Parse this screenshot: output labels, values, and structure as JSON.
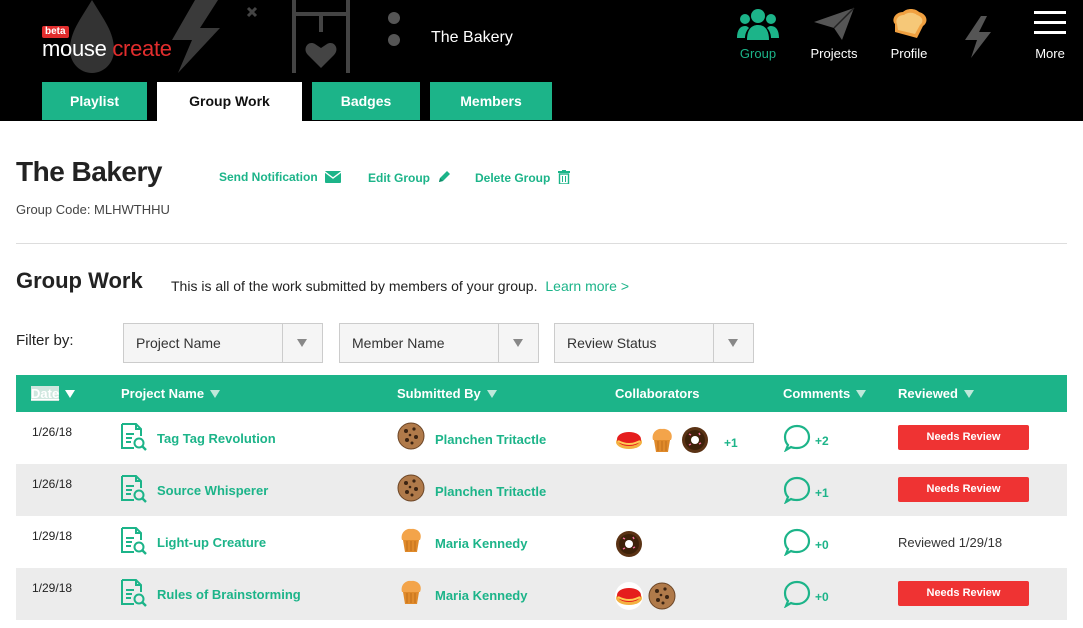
{
  "header": {
    "logo_beta": "beta",
    "logo_word1": "mouse",
    "logo_word2": "create",
    "site_title": "The Bakery",
    "nav": [
      {
        "label": "Group",
        "icon": "group-icon",
        "active": true
      },
      {
        "label": "Projects",
        "icon": "paper-plane-icon"
      },
      {
        "label": "Profile",
        "icon": "toast-icon"
      },
      {
        "label": "",
        "icon": "lightning-icon"
      },
      {
        "label": "More",
        "icon": "hamburger-menu-icon"
      }
    ],
    "tabs": [
      "Playlist",
      "Group Work",
      "Badges",
      "Members"
    ],
    "active_tab": "Group Work"
  },
  "group": {
    "title": "The Bakery",
    "actions": {
      "send_notification": "Send Notification",
      "edit_group": "Edit Group",
      "delete_group": "Delete Group"
    },
    "code": "Group Code: MLHWTHHU"
  },
  "group_work": {
    "title": "Group Work",
    "description": "This is all of the work submitted by members of your group.",
    "learn_more": "Learn more >"
  },
  "filters": {
    "label": "Filter by:",
    "project": "Project Name",
    "member": "Member Name",
    "status": "Review Status"
  },
  "table": {
    "columns": [
      "Date",
      "Project Name",
      "Submitted By",
      "Collaborators",
      "Comments",
      "Reviewed"
    ],
    "rows": [
      {
        "date": "1/26/18",
        "project": "Tag Tag Revolution",
        "submitter": "Planchen Tritactle",
        "submitter_avatar": "cookie",
        "collaborators": [
          "pie",
          "muffin",
          "donut"
        ],
        "collab_more": "+1",
        "comments": "+2",
        "review_label": "Needs Review",
        "reviewed": false
      },
      {
        "date": "1/26/18",
        "project": "Source Whisperer",
        "submitter": "Planchen Tritactle",
        "submitter_avatar": "cookie",
        "collaborators": [],
        "collab_more": "",
        "comments": "+1",
        "review_label": "Needs Review",
        "reviewed": false
      },
      {
        "date": "1/29/18",
        "project": "Light-up Creature",
        "submitter": "Maria Kennedy",
        "submitter_avatar": "muffin",
        "collaborators": [
          "donut"
        ],
        "collab_more": "",
        "comments": "+0",
        "review_label": "Reviewed 1/29/18",
        "reviewed": true
      },
      {
        "date": "1/29/18",
        "project": "Rules of Brainstorming",
        "submitter": "Maria Kennedy",
        "submitter_avatar": "muffin",
        "collaborators": [
          "pie",
          "cookie"
        ],
        "collab_more": "",
        "comments": "+0",
        "review_label": "Needs Review",
        "reviewed": false
      }
    ]
  },
  "colors": {
    "accent": "#1cb489",
    "alert": "#ef3333",
    "header_bg": "#000000"
  }
}
